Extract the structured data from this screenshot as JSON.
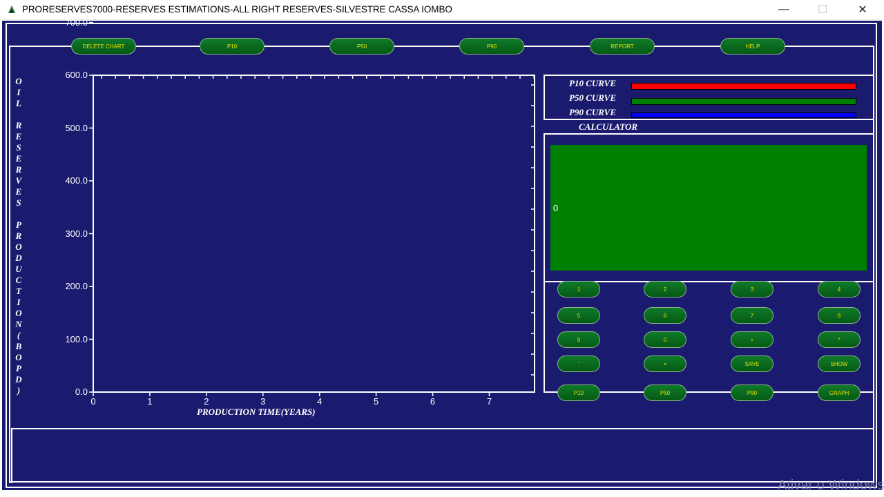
{
  "window": {
    "title": "PRORESERVES7000-RESERVES ESTIMATIONS-ALL RIGHT RESERVES-SILVESTRE CASSA IOMBO",
    "minimize": "—",
    "maximize": "☐",
    "close": "✕"
  },
  "toolbar": {
    "buttons": [
      "DELETE CHART",
      "P10",
      "P50",
      "P90",
      "REPORT",
      "HELP"
    ]
  },
  "chart_data": {
    "type": "line",
    "title": "",
    "xlabel": "PRODUCTION TIME(YEARS)",
    "ylabel": "O I L   R E S E R V E S   P R O D U C T I O N ( B O P D )",
    "yticks": [
      "0.0",
      "100.0",
      "200.0",
      "300.0",
      "400.0",
      "500.0",
      "600.0",
      "700.0"
    ],
    "xticks": [
      "0",
      "1",
      "2",
      "3",
      "4",
      "5",
      "6",
      "7"
    ],
    "xlim": [
      0,
      7.8
    ],
    "ylim": [
      0,
      600
    ],
    "series": []
  },
  "legend": {
    "items": [
      {
        "label": "P10 CURVE",
        "color": "#ff0000"
      },
      {
        "label": "P50 CURVE",
        "color": "#008000"
      },
      {
        "label": "P90 CURVE",
        "color": "#0000ff"
      }
    ]
  },
  "calculator": {
    "title": "CALCULATOR",
    "display": "0",
    "rows": [
      [
        "1",
        "2",
        "3",
        "4"
      ],
      [
        "5",
        "6",
        "7",
        "8"
      ],
      [
        "9",
        "0",
        "+",
        "*"
      ],
      [
        "'",
        "=",
        "SAVE",
        "SHOW"
      ],
      [
        "P10",
        "P50",
        "P90",
        "GRAPH"
      ]
    ]
  },
  "watermark": "Ativar o Windows",
  "colors": {
    "background": "#1a1a6e",
    "button_fill": "#0f7a2a",
    "button_text": "#e8e000",
    "display": "#008000"
  }
}
